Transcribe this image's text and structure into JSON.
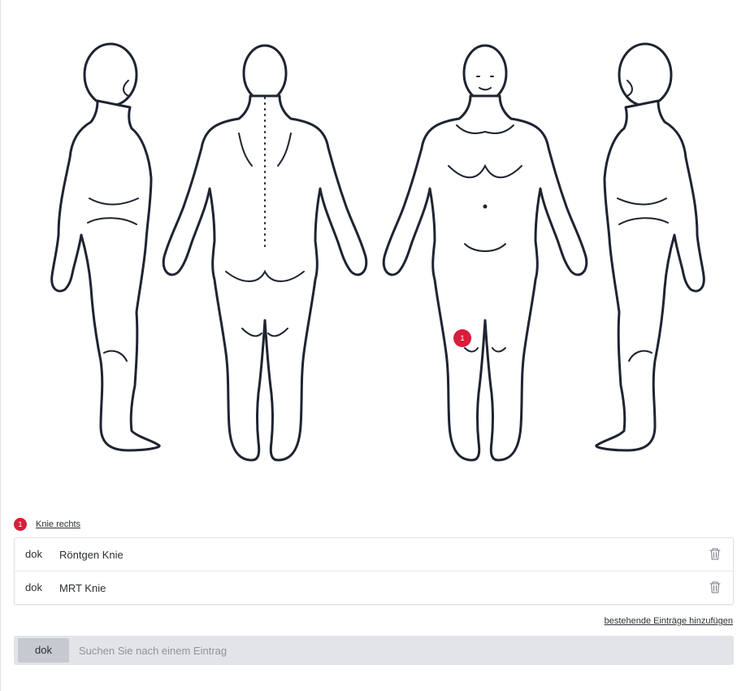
{
  "body_map": {
    "views": [
      {
        "name": "side-left"
      },
      {
        "name": "back"
      },
      {
        "name": "front"
      },
      {
        "name": "side-right"
      }
    ],
    "markers": [
      {
        "number": "1",
        "region": "Knie rechts"
      }
    ]
  },
  "region": {
    "badge": "1",
    "label": "Knie rechts"
  },
  "entries": [
    {
      "type": "dok",
      "title": "Röntgen Knie",
      "action_icon": "trash-icon"
    },
    {
      "type": "dok",
      "title": "MRT Knie",
      "action_icon": "trash-icon"
    }
  ],
  "add_existing_label": "bestehende Einträge hinzufügen",
  "search": {
    "type_label": "dok",
    "placeholder": "Suchen Sie nach einem Eintrag"
  },
  "colors": {
    "accent": "#d81e3c",
    "line": "#1f2431",
    "search_bar": "#e3e4e7"
  }
}
